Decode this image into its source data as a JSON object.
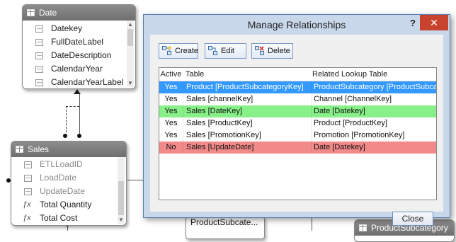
{
  "date_table": {
    "title": "Date",
    "fields": [
      "Datekey",
      "FullDateLabel",
      "DateDescription",
      "CalendarYear",
      "CalendarYearLabel"
    ]
  },
  "sales_table": {
    "title": "Sales",
    "fields": [
      {
        "label": "ETLLoadID",
        "kind": "column",
        "dimmed": true
      },
      {
        "label": "LoadDate",
        "kind": "column",
        "dimmed": true
      },
      {
        "label": "UpdateDate",
        "kind": "column",
        "dimmed": true
      },
      {
        "label": "Total Quantity",
        "kind": "measure",
        "dimmed": false
      },
      {
        "label": "Total Cost",
        "kind": "measure",
        "dimmed": false
      }
    ]
  },
  "partial_card_label": "ProductSubcategory",
  "partial_field_label": "ProductSubcate...",
  "dialog": {
    "title": "Manage Relationships",
    "help_label": "?",
    "close_glyph": "✕",
    "toolbar": {
      "create": "Create",
      "edit": "Edit",
      "delete": "Delete"
    },
    "columns": {
      "active": "Active",
      "table": "Table",
      "lookup": "Related Lookup Table"
    },
    "rows": [
      {
        "active": "Yes",
        "table": "Product [ProductSubcategoryKey]",
        "lookup": "ProductSubcategory [ProductSubcatego...",
        "state": "selected"
      },
      {
        "active": "Yes",
        "table": "Sales [channelKey]",
        "lookup": "Channel [ChannelKey]",
        "state": "normal"
      },
      {
        "active": "Yes",
        "table": "Sales [DateKey]",
        "lookup": "Date [Datekey]",
        "state": "green"
      },
      {
        "active": "Yes",
        "table": "Sales [ProductKey]",
        "lookup": "Product [ProductKey]",
        "state": "normal"
      },
      {
        "active": "Yes",
        "table": "Sales [PromotionKey]",
        "lookup": "Promotion [PromotionKey]",
        "state": "normal"
      },
      {
        "active": "No",
        "table": "Sales [UpdateDate]",
        "lookup": "Date [Datekey]",
        "state": "red"
      }
    ],
    "close_button": "Close"
  },
  "colors": {
    "selected": "#3399ff",
    "green_row": "#88f088",
    "red_row": "#f28a8a",
    "title_close": "#c7432e"
  }
}
